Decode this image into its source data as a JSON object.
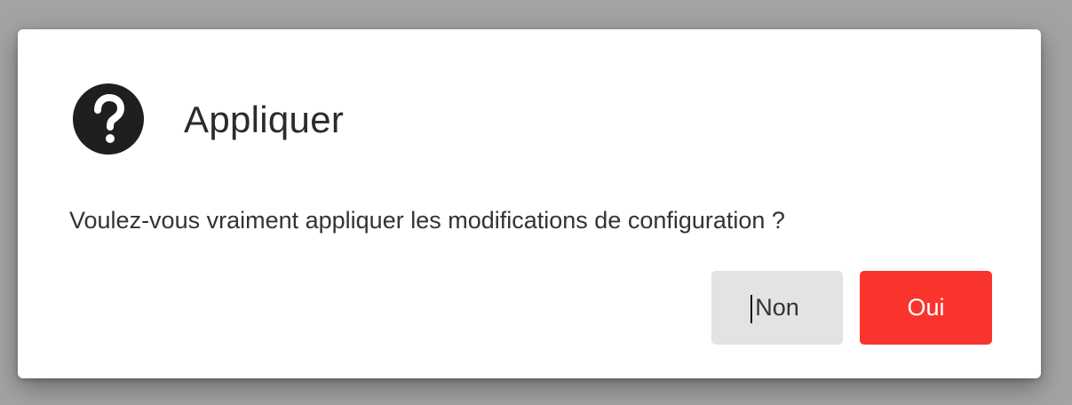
{
  "dialog": {
    "title": "Appliquer",
    "icon": "question-circle-icon",
    "message": "Voulez-vous vraiment appliquer les modifications de configuration ?",
    "buttons": {
      "no_label": "Non",
      "yes_label": "Oui"
    }
  },
  "colors": {
    "overlay": "#a3a3a3",
    "dialog_background": "#ffffff",
    "icon": "#1f1f1f",
    "no_button": "#e3e3e3",
    "yes_button": "#f9342c",
    "yes_button_text": "#ffffff"
  }
}
